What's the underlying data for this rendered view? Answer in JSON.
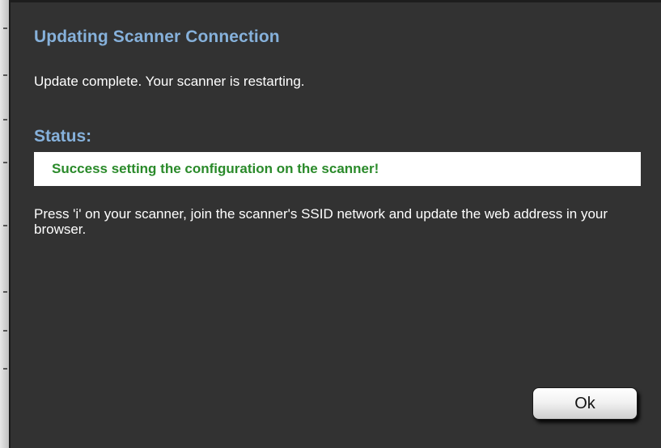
{
  "dialog": {
    "title": "Updating Scanner Connection",
    "message": "Update complete. Your scanner is restarting.",
    "status_heading": "Status:",
    "status_text": "Success setting the configuration on the scanner!",
    "instructions": "Press 'i' on your scanner, join the scanner's SSID network and update the web address in your browser.",
    "ok_label": "Ok"
  },
  "colors": {
    "dialog_background": "#323232",
    "heading_color": "#86b1db",
    "success_color": "#2a8a2a",
    "body_text": "#ffffff"
  }
}
